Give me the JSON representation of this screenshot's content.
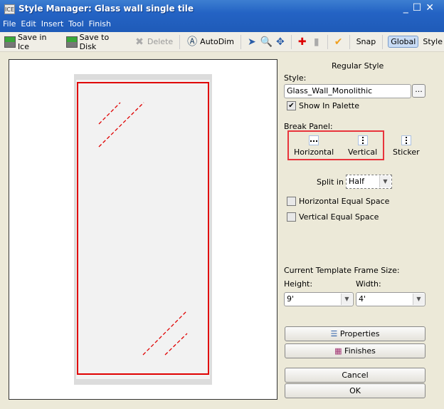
{
  "window": {
    "title": "Style Manager: Glass wall single tile",
    "icon_text": "ICE",
    "controls": [
      "minimize",
      "maximize",
      "close"
    ]
  },
  "menu": [
    "File",
    "Edit",
    "Insert",
    "Tool",
    "Finish"
  ],
  "toolbar": {
    "save_ice": "Save in Ice",
    "save_disk": "Save to Disk",
    "delete": "Delete",
    "autodim": "AutoDim",
    "snap": "Snap",
    "global": "Global",
    "style": "Style"
  },
  "panel": {
    "heading": "Regular Style",
    "style_label": "Style:",
    "style_value": "Glass_Wall_Monolithic",
    "browse": "...",
    "show_in_palette": "Show In Palette",
    "show_in_palette_checked": true,
    "break_panel_label": "Break Panel:",
    "break_options": [
      "Horizontal",
      "Vertical",
      "Sticker"
    ],
    "split_label": "Split in",
    "split_value": "Half",
    "horizontal_equal": "Horizontal Equal Space",
    "horizontal_equal_checked": false,
    "vertical_equal": "Vertical Equal Space",
    "vertical_equal_checked": false,
    "frame_size_label": "Current Template Frame Size:",
    "height_label": "Height:",
    "height_value": "9'",
    "width_label": "Width:",
    "width_value": "4'",
    "properties": "Properties",
    "finishes": "Finishes",
    "cancel": "Cancel",
    "ok": "OK"
  },
  "colors": {
    "title_bar": "#2463c4",
    "highlight": "#e8343c",
    "glass_outline": "#e00000"
  }
}
